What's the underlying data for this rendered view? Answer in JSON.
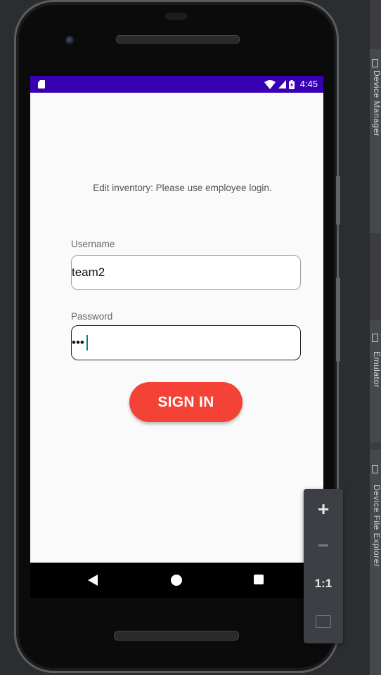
{
  "app": {
    "prompt": "Edit inventory: Please use employee login.",
    "username": {
      "label": "Username",
      "value": "team2"
    },
    "password": {
      "label": "Password",
      "value": "•••"
    },
    "sign_in_label": "SIGN IN"
  },
  "status_bar": {
    "time": "4:45",
    "icons": [
      "sd-card-icon",
      "wifi-icon",
      "signal-icon",
      "battery-icon"
    ],
    "color": "#3700b3"
  },
  "navigation": {
    "icons": [
      "back-icon",
      "home-icon",
      "recent-apps-icon"
    ]
  },
  "zoom_panel": {
    "zoom_in": "+",
    "zoom_out": "−",
    "actual_size": "1:1",
    "icons": [
      "zoom-in-icon",
      "zoom-out-icon",
      "fit-screen-icon"
    ]
  },
  "ide_side_panel": {
    "labels": [
      "Device Manager",
      "Emulator",
      "Device File Explorer"
    ]
  },
  "colors": {
    "accent": "#f44336",
    "status_bar": "#3700b3",
    "caret": "#00897b"
  }
}
